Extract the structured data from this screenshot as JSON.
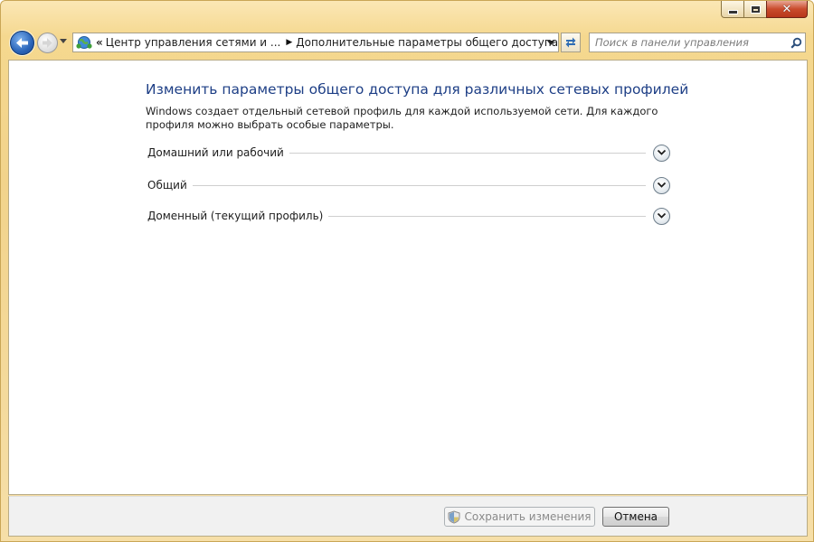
{
  "window": {
    "controls": {
      "minimize_icon": "minimize-icon",
      "maximize_icon": "maximize-icon",
      "close_icon": "close-icon",
      "close_glyph": "✕"
    }
  },
  "nav": {
    "back_icon": "back-arrow-icon",
    "forward_icon": "forward-arrow-icon",
    "history_icon": "chevron-down-icon"
  },
  "address_bar": {
    "overflow": "«",
    "segments": [
      "Центр управления сетями и ...",
      "Дополнительные параметры общего доступа"
    ]
  },
  "search": {
    "placeholder": "Поиск в панели управления"
  },
  "main": {
    "title": "Изменить параметры общего доступа для различных сетевых профилей",
    "description": "Windows создает отдельный сетевой профиль для каждой используемой сети. Для каждого профиля можно выбрать особые параметры.",
    "sections": [
      {
        "label": "Домашний или рабочий"
      },
      {
        "label": "Общий"
      },
      {
        "label": "Доменный (текущий профиль)"
      }
    ]
  },
  "footer": {
    "save_label": "Сохранить изменения",
    "cancel_label": "Отмена"
  },
  "colors": {
    "title_blue": "#1e3f86",
    "frame_gold": "#f2d38b",
    "close_red": "#c94b2c"
  }
}
